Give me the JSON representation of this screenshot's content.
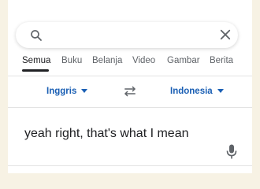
{
  "search": {
    "value": "",
    "placeholder": ""
  },
  "tabs": [
    {
      "label": "Semua",
      "active": true
    },
    {
      "label": "Buku"
    },
    {
      "label": "Belanja"
    },
    {
      "label": "Video"
    },
    {
      "label": "Gambar"
    },
    {
      "label": "Berita"
    }
  ],
  "translate": {
    "source_lang": "Inggris",
    "target_lang": "Indonesia",
    "source_text": "yeah right, that's what I mean"
  },
  "icons": {
    "search": "search-icon",
    "clear": "close-icon",
    "swap": "swap-arrows-icon",
    "mic": "microphone-icon"
  },
  "colors": {
    "accent": "#1a5fb4",
    "background": "#f7f2e4",
    "text": "#202124",
    "muted": "#5f6368"
  }
}
